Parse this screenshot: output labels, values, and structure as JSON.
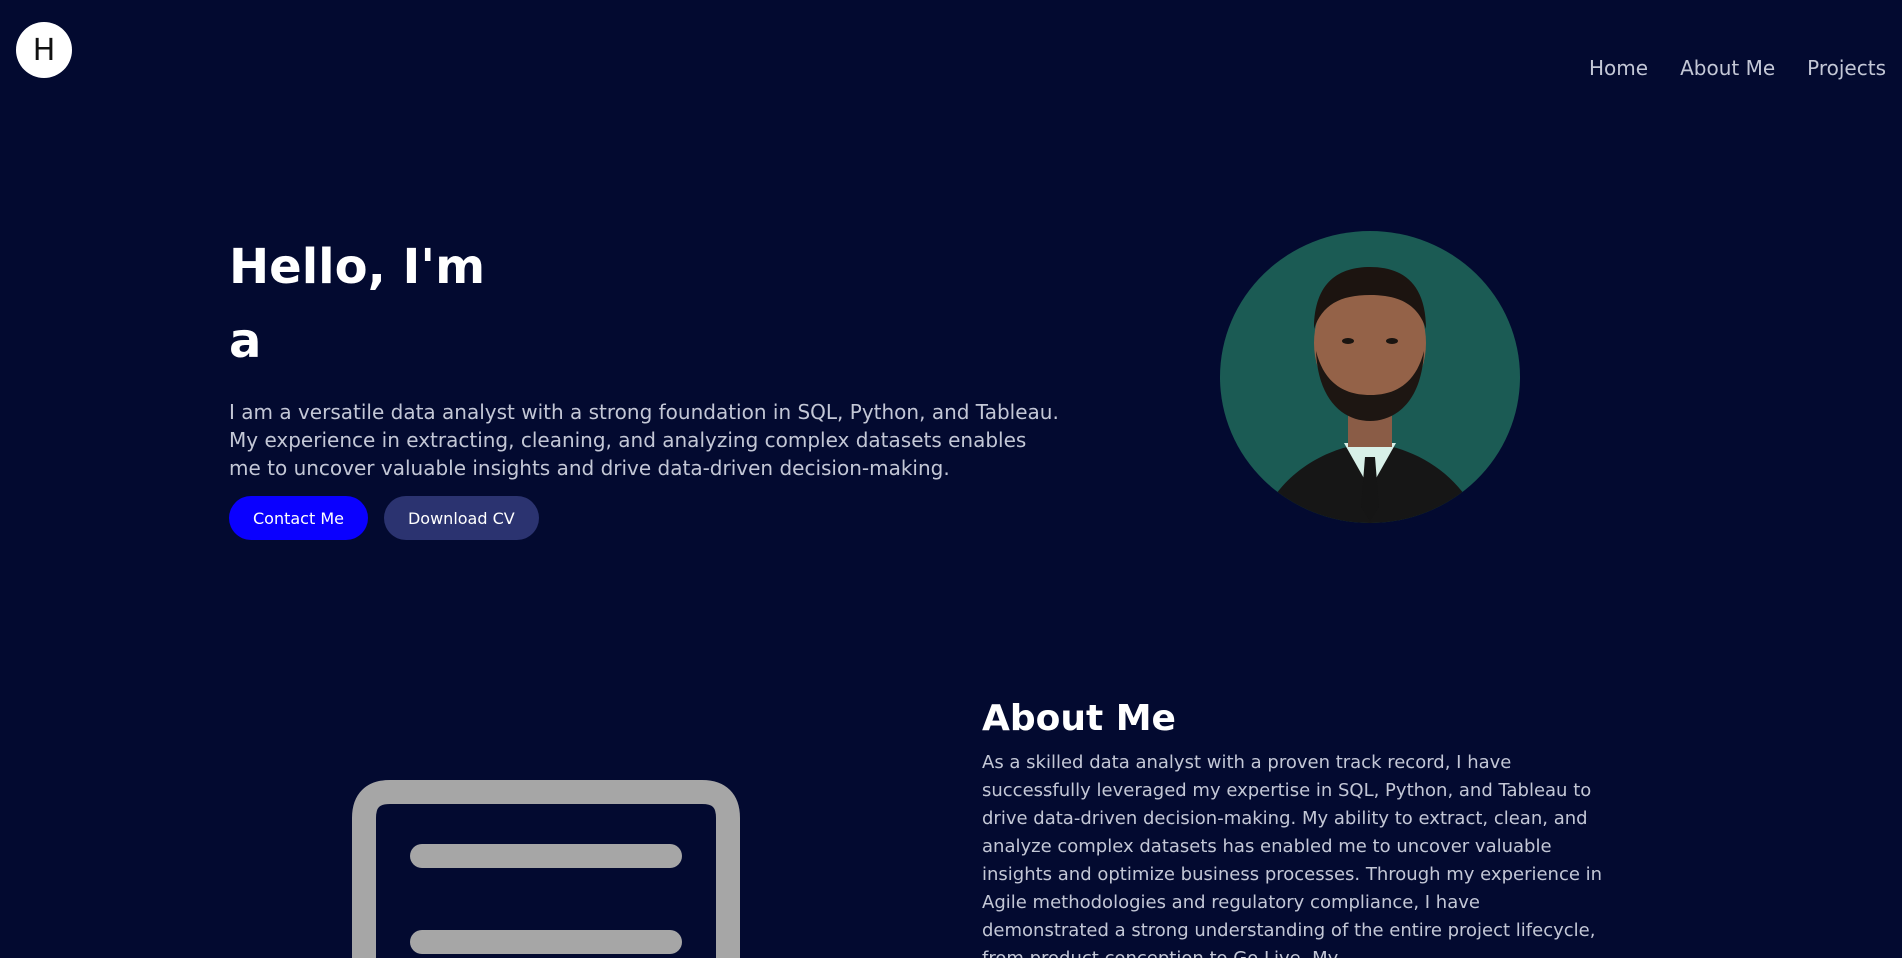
{
  "logo": {
    "letter": "H"
  },
  "nav": {
    "items": [
      {
        "label": "Home"
      },
      {
        "label": "About Me"
      },
      {
        "label": "Projects"
      }
    ]
  },
  "hero": {
    "title_line1": "Hello, I'm",
    "title_line2": "a",
    "description": "I am a versatile data analyst with a strong foundation in SQL, Python, and Tableau. My experience in extracting, cleaning, and analyzing complex datasets enables me to uncover valuable insights and drive data-driven decision-making.",
    "contact_label": "Contact Me",
    "download_label": "Download CV"
  },
  "about": {
    "title": "About Me",
    "text": "As a skilled data analyst with a proven track record, I have successfully leveraged my expertise in SQL, Python, and Tableau to drive data-driven decision-making. My ability to extract, clean, and analyze complex datasets has enabled me to uncover valuable insights and optimize business processes. Through my experience in Agile methodologies and regulatory compliance, I have demonstrated a strong understanding of the entire project lifecycle, from product conception to Go Live. My"
  },
  "colors": {
    "background": "#030a30",
    "primary_button": "#0a00ff",
    "secondary_button": "#2b3370",
    "avatar_bg": "#1b5b54",
    "icon_gray": "#a6a6a6"
  },
  "icons": {
    "document": "document-icon"
  }
}
